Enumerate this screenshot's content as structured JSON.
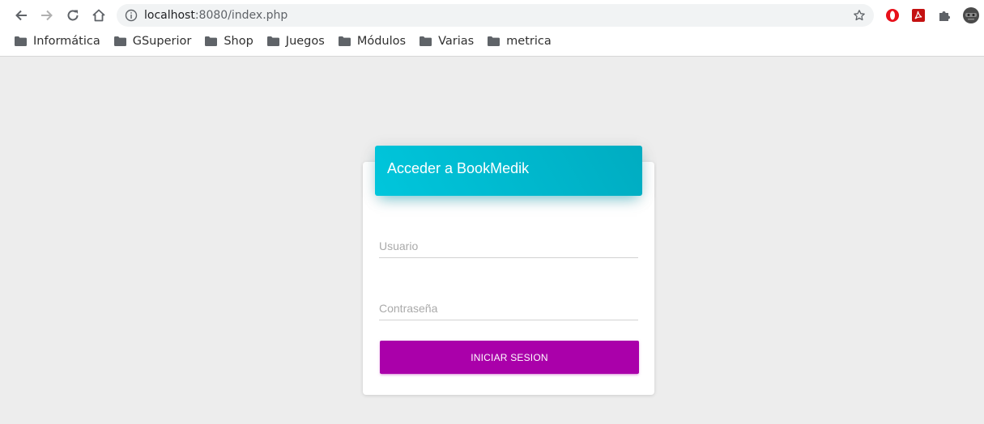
{
  "browser": {
    "url_host": "localhost",
    "url_rest": ":8080/index.php",
    "bookmarks": [
      {
        "label": "Informática"
      },
      {
        "label": "GSuperior"
      },
      {
        "label": "Shop"
      },
      {
        "label": "Juegos"
      },
      {
        "label": "Módulos"
      },
      {
        "label": "Varias"
      },
      {
        "label": "metrica"
      }
    ],
    "icons": [
      "back-icon",
      "forward-icon",
      "reload-icon",
      "home-icon",
      "info-icon",
      "star-icon",
      "opera-icon",
      "pdf-icon",
      "puzzle-icon",
      "avatar-icon",
      "folder-icon"
    ]
  },
  "login": {
    "title": "Acceder a BookMedik",
    "username_placeholder": "Usuario",
    "password_placeholder": "Contraseña",
    "submit_label": "INICIAR SESION"
  },
  "colors": {
    "header_cyan": "#00bcd4",
    "button_purple": "#aa00aa",
    "page_bg": "#ededed"
  }
}
